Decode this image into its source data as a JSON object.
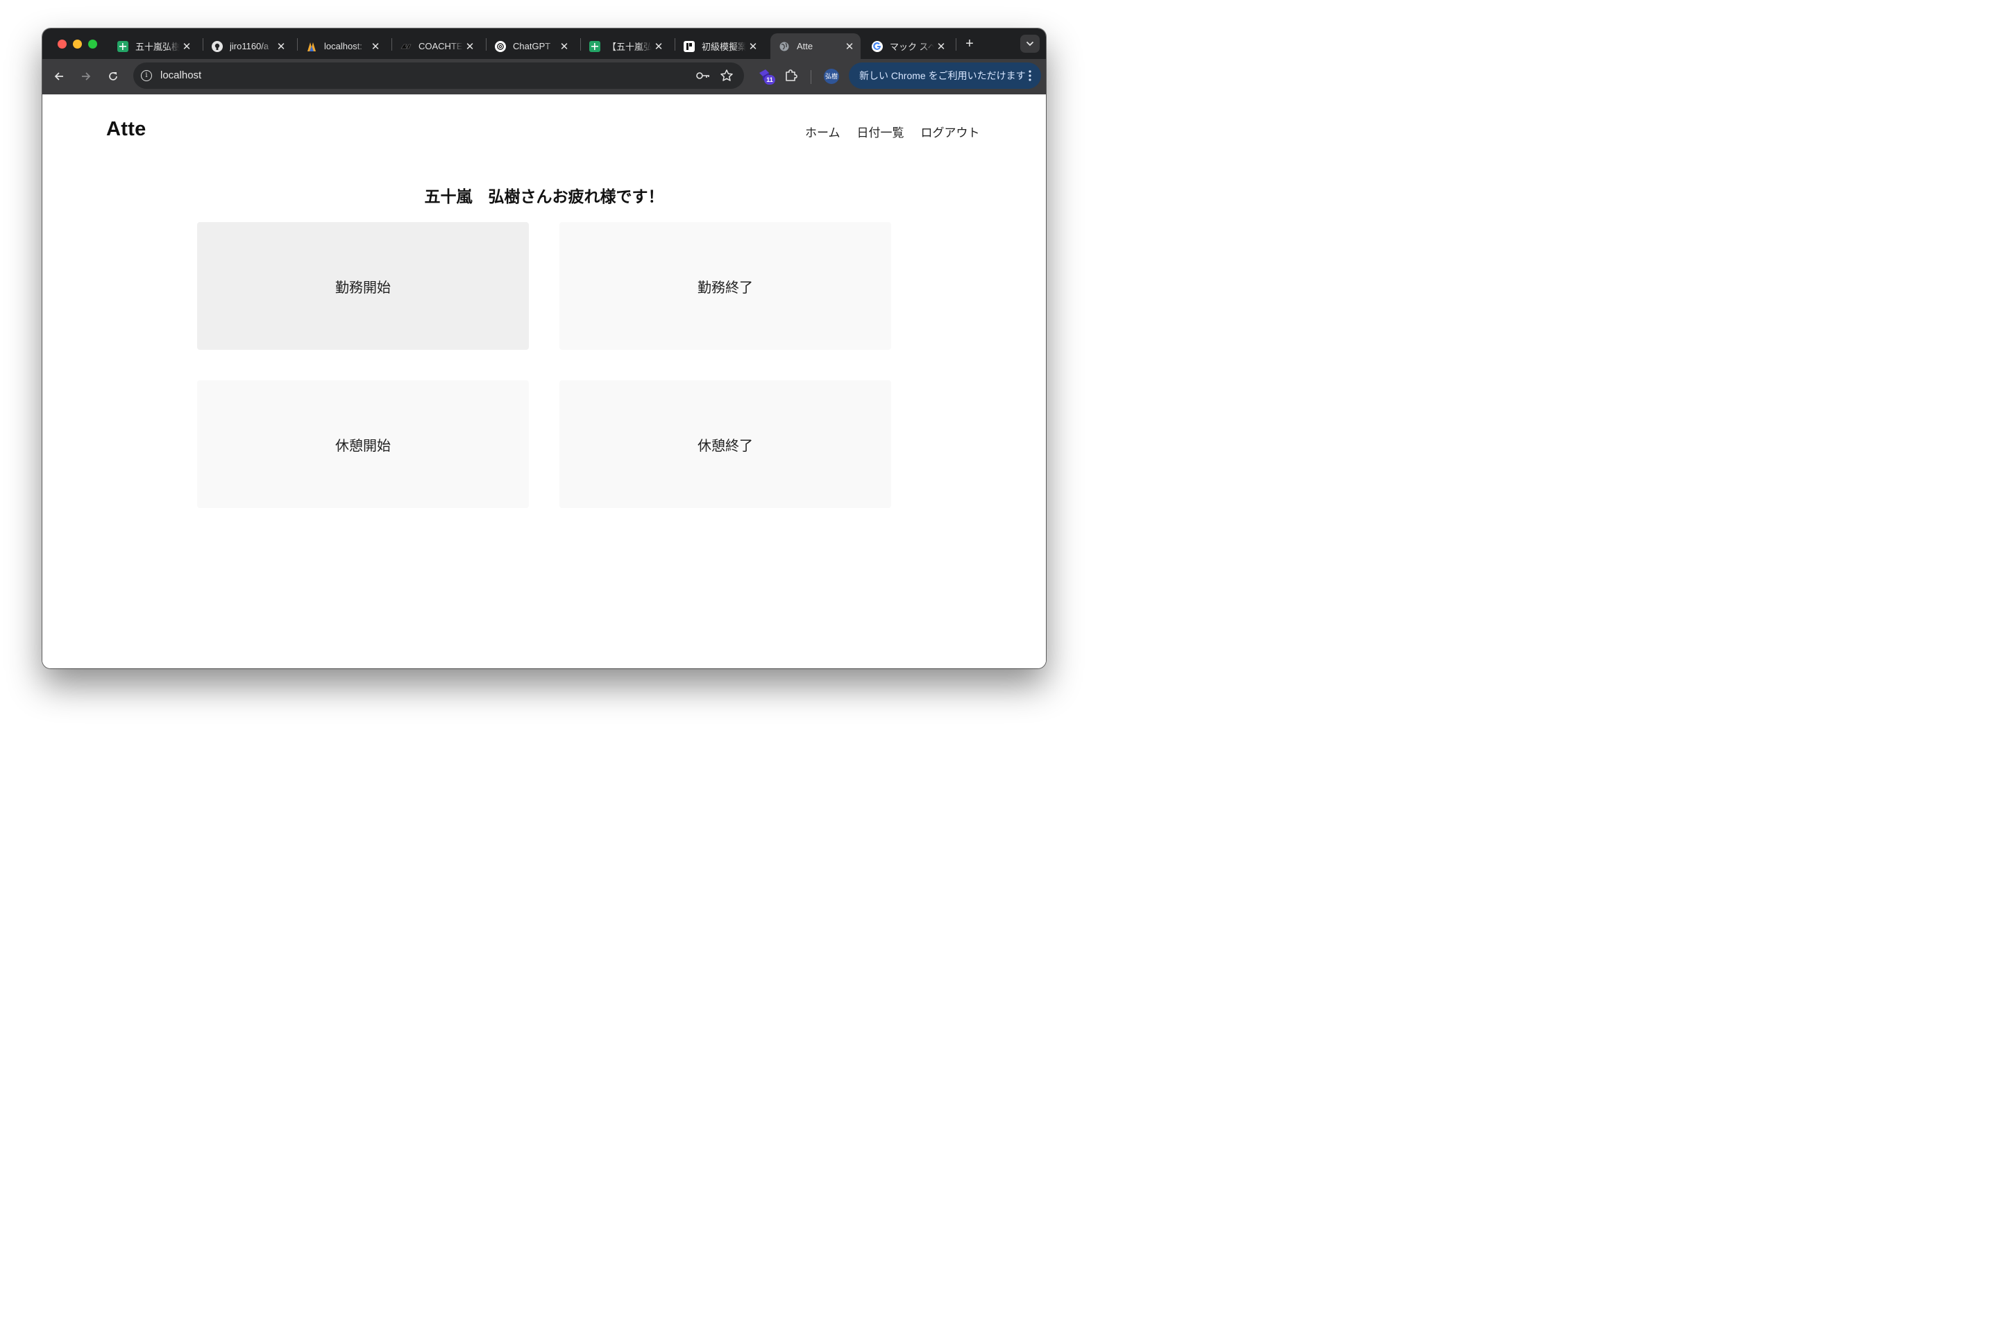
{
  "browser": {
    "tabs": [
      {
        "title": "五十嵐弘樹",
        "favicon": "google-sheets-icon",
        "active": false
      },
      {
        "title": "jiro1160/a",
        "favicon": "github-icon",
        "active": false
      },
      {
        "title": "localhost:",
        "favicon": "laravel-debug-icon",
        "active": false
      },
      {
        "title": "COACHTE",
        "favicon": "coachtech-icon",
        "active": false
      },
      {
        "title": "ChatGPT",
        "favicon": "chatgpt-icon",
        "active": false
      },
      {
        "title": "【五十嵐弘",
        "favicon": "google-sheets-icon",
        "active": false
      },
      {
        "title": "初級模擬案",
        "favicon": "notion-icon",
        "active": false
      },
      {
        "title": "Atte",
        "favicon": "globe-icon",
        "active": true
      },
      {
        "title": "マック スペ",
        "favicon": "google-icon",
        "active": false
      }
    ],
    "address": "localhost",
    "extension_badge": "11",
    "profile_label": "弘樹",
    "update_banner": "新しい Chrome をご利用いただけます",
    "colors": {
      "tabstrip": "#1f2022",
      "toolbar": "#3c3c3e",
      "update_pill": "#1c3f66"
    }
  },
  "app": {
    "logo": "Atte",
    "nav": {
      "home": "ホーム",
      "date_list": "日付一覧",
      "logout": "ログアウト"
    },
    "greeting": "五十嵐　弘樹さんお疲れ様です！",
    "buttons": {
      "work_start": "勤務開始",
      "work_end": "勤務終了",
      "break_start": "休憩開始",
      "break_end": "休憩終了"
    },
    "colors": {
      "enabled_button": "#efefef",
      "disabled_button": "#f9f9f9"
    }
  }
}
